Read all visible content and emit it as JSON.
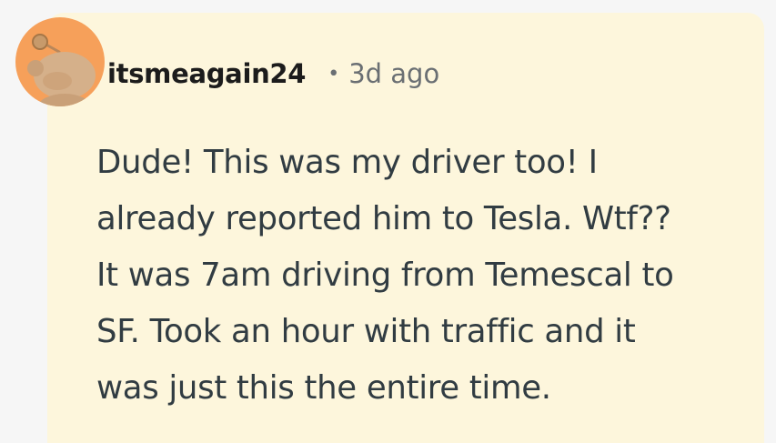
{
  "comment": {
    "username": "itsmeagain24",
    "separator": "•",
    "timestamp": "3d ago",
    "lines": [
      "Dude! This was my driver too! I",
      "already reported him to Tesla. Wtf??",
      "It was 7am driving from Temescal to",
      "SF. Took an hour with traffic and it",
      "was just this the entire time."
    ]
  },
  "avatar": {
    "icon": "snoo-avatar-icon",
    "background_color": "#f6a05a"
  },
  "colors": {
    "card_background": "#fdf6dc",
    "page_background": "#f6f6f6",
    "username": "#1c1c1c",
    "meta": "#6a6f73",
    "body_text": "#313c42"
  }
}
